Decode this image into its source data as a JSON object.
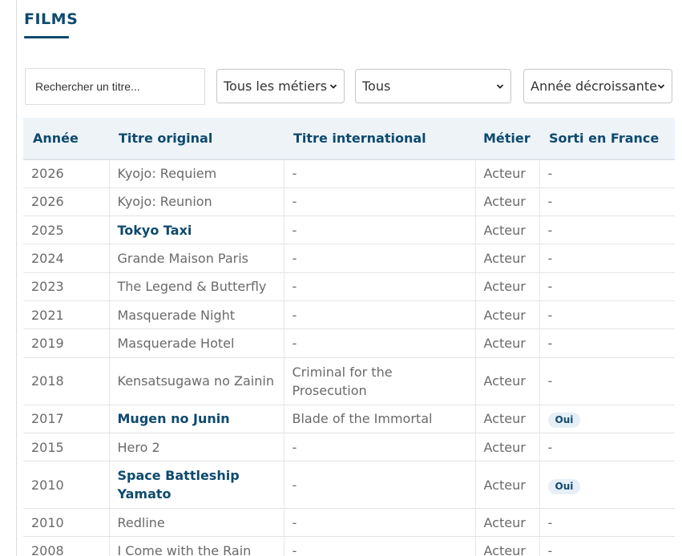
{
  "section": {
    "title": "FILMS"
  },
  "filters": {
    "search_placeholder": "Rechercher un titre...",
    "metier_selected": "Tous les métiers",
    "tous_selected": "Tous",
    "order_selected": "Année décroissante"
  },
  "table": {
    "headers": [
      "Année",
      "Titre original",
      "Titre international",
      "Métier",
      "Sorti en France"
    ],
    "rows": [
      {
        "year": "2026",
        "title": "Kyojo: Requiem",
        "intl": "-",
        "metier": "Acteur",
        "france": "-",
        "link": false
      },
      {
        "year": "2026",
        "title": "Kyojo: Reunion",
        "intl": "-",
        "metier": "Acteur",
        "france": "-",
        "link": false
      },
      {
        "year": "2025",
        "title": "Tokyo Taxi",
        "intl": "-",
        "metier": "Acteur",
        "france": "-",
        "link": true
      },
      {
        "year": "2024",
        "title": "Grande Maison Paris",
        "intl": "-",
        "metier": "Acteur",
        "france": "-",
        "link": false
      },
      {
        "year": "2023",
        "title": "The Legend & Butterfly",
        "intl": "-",
        "metier": "Acteur",
        "france": "-",
        "link": false
      },
      {
        "year": "2021",
        "title": "Masquerade Night",
        "intl": "-",
        "metier": "Acteur",
        "france": "-",
        "link": false
      },
      {
        "year": "2019",
        "title": "Masquerade Hotel",
        "intl": "-",
        "metier": "Acteur",
        "france": "-",
        "link": false
      },
      {
        "year": "2018",
        "title": "Kensatsugawa no Zainin",
        "intl": "Criminal for the Prosecution",
        "metier": "Acteur",
        "france": "-",
        "link": false,
        "tall": true
      },
      {
        "year": "2017",
        "title": "Mugen no Junin",
        "intl": "Blade of the Immortal",
        "metier": "Acteur",
        "france": "Oui",
        "link": true
      },
      {
        "year": "2015",
        "title": "Hero 2",
        "intl": "-",
        "metier": "Acteur",
        "france": "-",
        "link": false
      },
      {
        "year": "2010",
        "title": "Space Battleship Yamato",
        "intl": "-",
        "metier": "Acteur",
        "france": "Oui",
        "link": true,
        "tall": true
      },
      {
        "year": "2010",
        "title": "Redline",
        "intl": "-",
        "metier": "Acteur",
        "france": "-",
        "link": false
      },
      {
        "year": "2008",
        "title": "I Come with the Rain",
        "intl": "-",
        "metier": "Acteur",
        "france": "-",
        "link": false
      }
    ]
  },
  "icons": {
    "select_arrow": "chevron-down-icon"
  },
  "colors": {
    "accent": "#0d4a6e",
    "header_bg": "#eef3f8",
    "badge_bg": "#e6eef6"
  }
}
